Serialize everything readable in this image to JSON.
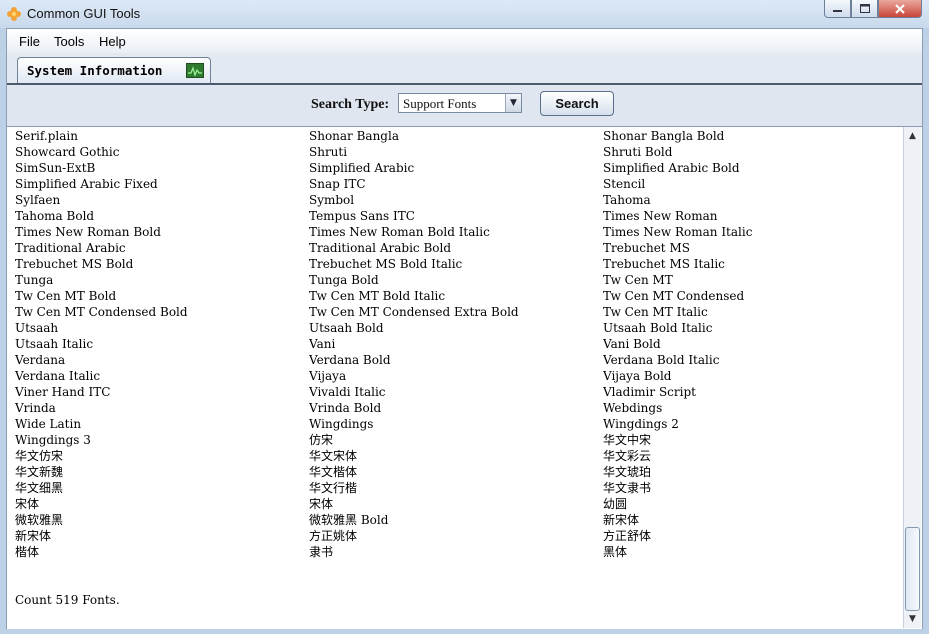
{
  "window": {
    "title": "Common GUI Tools",
    "icon": "flower-app-icon",
    "controls": {
      "minimize": "minimize-icon",
      "maximize": "maximize-icon",
      "close": "close-icon"
    }
  },
  "menu": {
    "items": [
      "File",
      "Tools",
      "Help"
    ]
  },
  "tab": {
    "label": "System Information",
    "icon": "monitor-icon"
  },
  "search": {
    "label": "Search Type:",
    "selected": "Support Fonts",
    "button": "Search"
  },
  "fonts": [
    "Serif.plain",
    "Shonar Bangla",
    "Shonar Bangla Bold",
    "Showcard Gothic",
    "Shruti",
    "Shruti Bold",
    "SimSun-ExtB",
    "Simplified Arabic",
    "Simplified Arabic Bold",
    "Simplified Arabic Fixed",
    "Snap ITC",
    "Stencil",
    "Sylfaen",
    "Symbol",
    "Tahoma",
    "Tahoma Bold",
    "Tempus Sans ITC",
    "Times New Roman",
    "Times New Roman Bold",
    "Times New Roman Bold Italic",
    "Times New Roman Italic",
    "Traditional Arabic",
    "Traditional Arabic Bold",
    "Trebuchet MS",
    "Trebuchet MS Bold",
    "Trebuchet MS Bold Italic",
    "Trebuchet MS Italic",
    "Tunga",
    "Tunga Bold",
    "Tw Cen MT",
    "Tw Cen MT Bold",
    "Tw Cen MT Bold Italic",
    "Tw Cen MT Condensed",
    "Tw Cen MT Condensed Bold",
    "Tw Cen MT Condensed Extra Bold",
    "Tw Cen MT Italic",
    "Utsaah",
    "Utsaah Bold",
    "Utsaah Bold Italic",
    "Utsaah Italic",
    "Vani",
    "Vani Bold",
    "Verdana",
    "Verdana Bold",
    "Verdana Bold Italic",
    "Verdana Italic",
    "Vijaya",
    "Vijaya Bold",
    "Viner Hand ITC",
    "Vivaldi Italic",
    "Vladimir Script",
    "Vrinda",
    "Vrinda Bold",
    "Webdings",
    "Wide Latin",
    "Wingdings",
    "Wingdings 2",
    "Wingdings 3",
    "仿宋",
    "华文中宋",
    "华文仿宋",
    "华文宋体",
    "华文彩云",
    "华文新魏",
    "华文楷体",
    "华文琥珀",
    "华文细黑",
    "华文行楷",
    "华文隶书",
    "宋体",
    "宋体",
    "幼圆",
    "微软雅黑",
    "微软雅黑 Bold",
    "新宋体",
    "新宋体",
    "方正姚体",
    "方正舒体",
    "楷体",
    "隶书",
    "黑体"
  ],
  "status": {
    "count_text": "Count 519 Fonts."
  }
}
